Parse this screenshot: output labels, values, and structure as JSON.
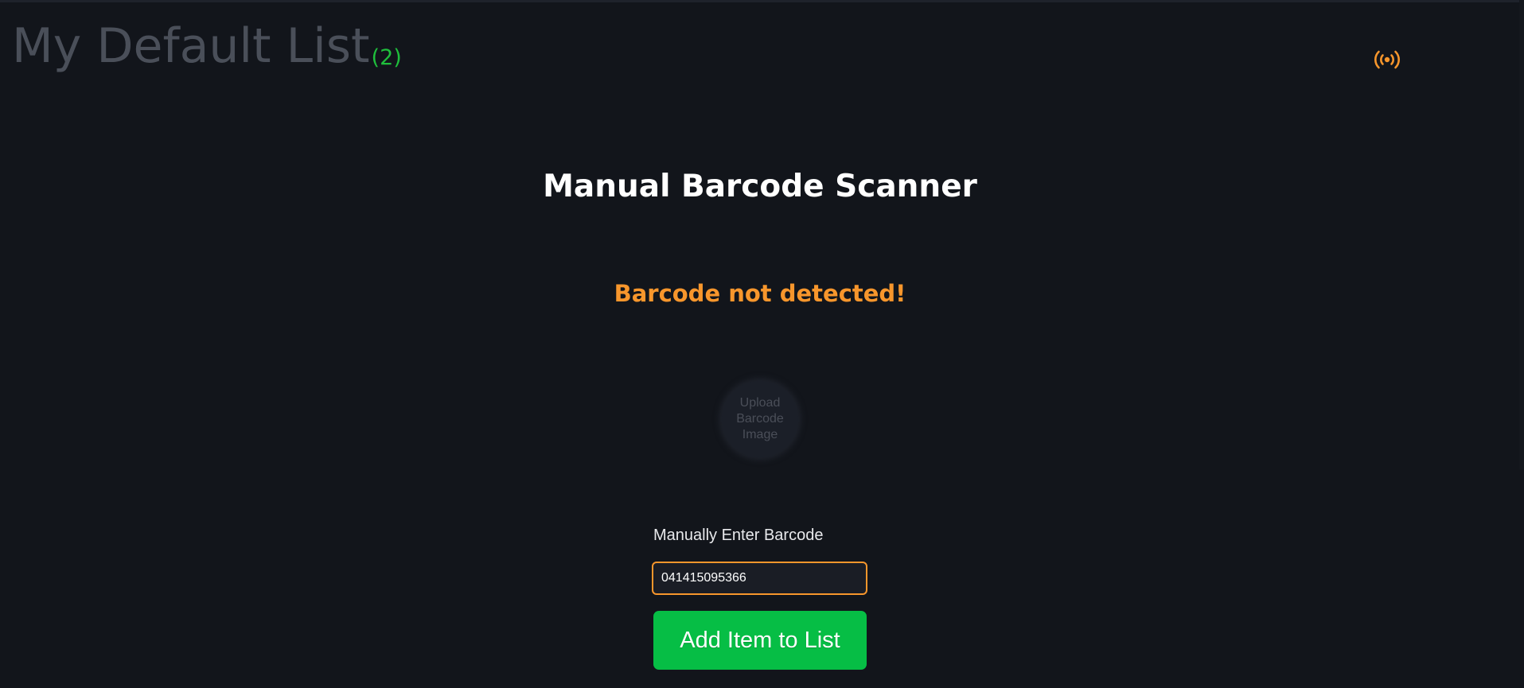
{
  "header": {
    "list_title": "My Default List",
    "item_count": "(2)",
    "signal_icon": "broadcast-signal-icon"
  },
  "scanner": {
    "title": "Manual Barcode Scanner",
    "status_message": "Barcode not detected!",
    "upload_label": "Upload Barcode Image",
    "manual_label": "Manually Enter Barcode",
    "barcode_value": "041415095366",
    "add_button_label": "Add Item to List"
  },
  "colors": {
    "background": "#12151b",
    "accent_orange": "#f7962c",
    "accent_green": "#06be45",
    "title_muted": "#4a4f59"
  }
}
